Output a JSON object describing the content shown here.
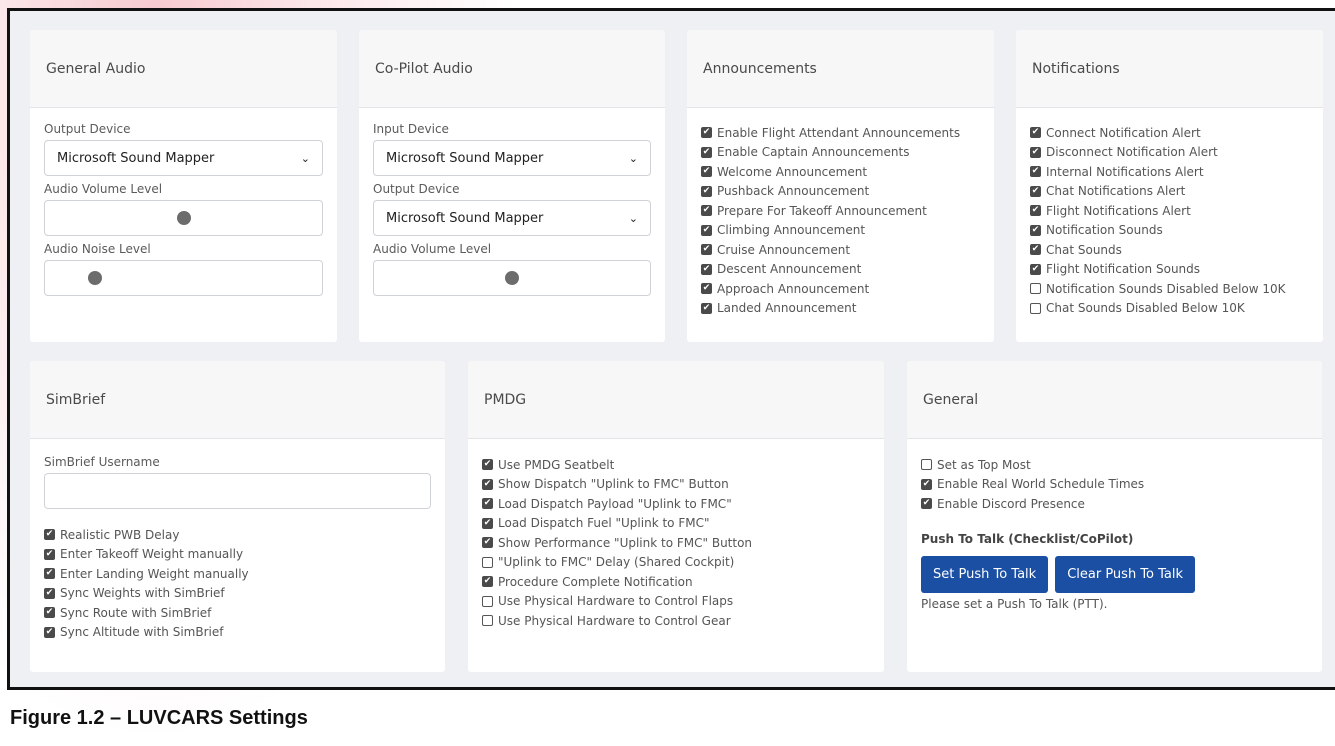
{
  "general_audio": {
    "title": "General Audio",
    "output_device_label": "Output Device",
    "output_device_value": "Microsoft Sound Mapper",
    "volume_label": "Audio Volume Level",
    "volume_level": 0.5,
    "noise_label": "Audio Noise Level",
    "noise_level": 0.18
  },
  "copilot_audio": {
    "title": "Co-Pilot Audio",
    "input_device_label": "Input Device",
    "input_device_value": "Microsoft Sound Mapper",
    "output_device_label": "Output Device",
    "output_device_value": "Microsoft Sound Mapper",
    "volume_label": "Audio Volume Level",
    "volume_level": 0.5
  },
  "announcements": {
    "title": "Announcements",
    "items": [
      {
        "label": "Enable Flight Attendant Announcements",
        "checked": true
      },
      {
        "label": "Enable Captain Announcements",
        "checked": true
      },
      {
        "label": "Welcome Announcement",
        "checked": true
      },
      {
        "label": "Pushback Announcement",
        "checked": true
      },
      {
        "label": "Prepare For Takeoff Announcement",
        "checked": true
      },
      {
        "label": "Climbing Announcement",
        "checked": true
      },
      {
        "label": "Cruise Announcement",
        "checked": true
      },
      {
        "label": "Descent Announcement",
        "checked": true
      },
      {
        "label": "Approach Announcement",
        "checked": true
      },
      {
        "label": "Landed Announcement",
        "checked": true
      }
    ]
  },
  "notifications": {
    "title": "Notifications",
    "items": [
      {
        "label": "Connect Notification Alert",
        "checked": true
      },
      {
        "label": "Disconnect Notification Alert",
        "checked": true
      },
      {
        "label": "Internal Notifications Alert",
        "checked": true
      },
      {
        "label": "Chat Notifications Alert",
        "checked": true
      },
      {
        "label": "Flight Notifications Alert",
        "checked": true
      },
      {
        "label": "Notification Sounds",
        "checked": true
      },
      {
        "label": "Chat Sounds",
        "checked": true
      },
      {
        "label": "Flight Notification Sounds",
        "checked": true
      },
      {
        "label": "Notification Sounds Disabled Below 10K",
        "checked": false
      },
      {
        "label": "Chat Sounds Disabled Below 10K",
        "checked": false
      }
    ]
  },
  "simbrief": {
    "title": "SimBrief",
    "username_label": "SimBrief Username",
    "username_value": "",
    "items": [
      {
        "label": "Realistic PWB Delay",
        "checked": true
      },
      {
        "label": "Enter Takeoff Weight manually",
        "checked": true
      },
      {
        "label": "Enter Landing Weight manually",
        "checked": true
      },
      {
        "label": "Sync Weights with SimBrief",
        "checked": true
      },
      {
        "label": "Sync Route with SimBrief",
        "checked": true
      },
      {
        "label": "Sync Altitude with SimBrief",
        "checked": true
      }
    ]
  },
  "pmdg": {
    "title": "PMDG",
    "items": [
      {
        "label": "Use PMDG Seatbelt",
        "checked": true
      },
      {
        "label": "Show Dispatch \"Uplink to FMC\" Button",
        "checked": true
      },
      {
        "label": "Load Dispatch Payload \"Uplink to FMC\"",
        "checked": true
      },
      {
        "label": "Load Dispatch Fuel \"Uplink to FMC\"",
        "checked": true
      },
      {
        "label": "Show Performance \"Uplink to FMC\" Button",
        "checked": true
      },
      {
        "label": "\"Uplink to FMC\" Delay (Shared Cockpit)",
        "checked": false
      },
      {
        "label": "Procedure Complete Notification",
        "checked": true
      },
      {
        "label": "Use Physical Hardware to Control Flaps",
        "checked": false
      },
      {
        "label": "Use Physical Hardware to Control Gear",
        "checked": false
      }
    ]
  },
  "general": {
    "title": "General",
    "items": [
      {
        "label": "Set as Top Most",
        "checked": false
      },
      {
        "label": "Enable Real World Schedule Times",
        "checked": true
      },
      {
        "label": "Enable Discord Presence",
        "checked": true
      }
    ],
    "ptt_title": "Push To Talk (Checklist/CoPilot)",
    "set_ptt_label": "Set Push To Talk",
    "clear_ptt_label": "Clear Push To Talk",
    "ptt_note": "Please set a Push To Talk (PTT)."
  },
  "caption": "Figure 1.2 – LUVCARS Settings",
  "colors": {
    "button": "#1a4fa3",
    "panel_bg": "#eef0f4"
  }
}
